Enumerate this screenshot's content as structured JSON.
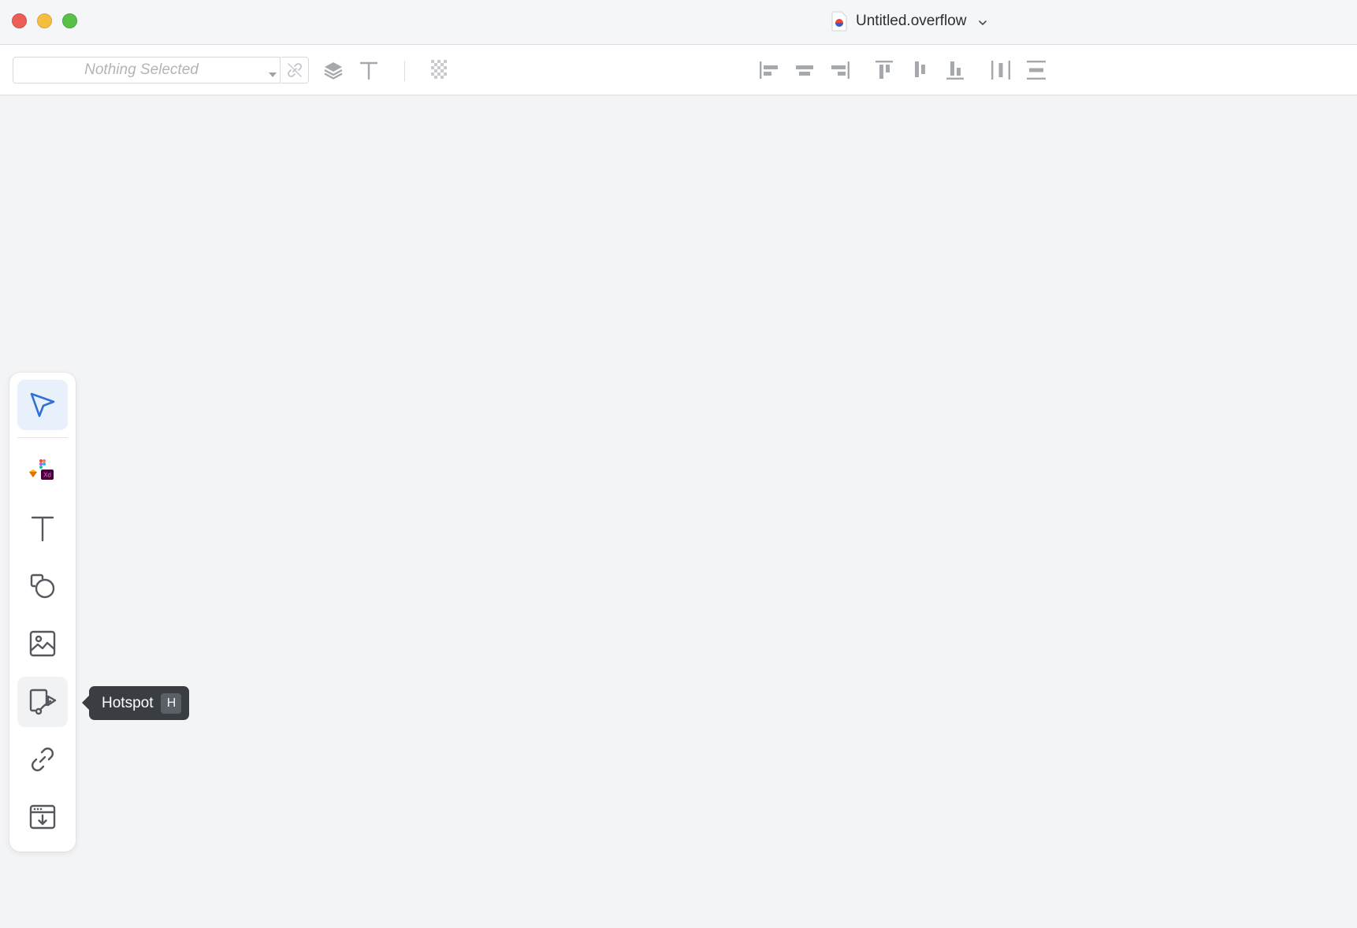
{
  "window": {
    "title": "Untitled.overflow"
  },
  "toolbar": {
    "selection_placeholder": "Nothing Selected"
  },
  "tools": [
    {
      "name": "select",
      "icon": "pointer-icon",
      "active": true
    },
    {
      "name": "import-design",
      "icon": "figma-sketch-xd-icon"
    },
    {
      "name": "text",
      "icon": "text-icon"
    },
    {
      "name": "shapes",
      "icon": "shapes-icon"
    },
    {
      "name": "image",
      "icon": "image-icon"
    },
    {
      "name": "hotspot",
      "icon": "hotspot-icon",
      "hover": true
    },
    {
      "name": "link",
      "icon": "link-icon"
    },
    {
      "name": "embed",
      "icon": "embed-icon"
    }
  ],
  "tooltip": {
    "label": "Hotspot",
    "shortcut": "H"
  },
  "colors": {
    "accent": "#2f6fd6",
    "tooltip_bg": "#3a3d42"
  }
}
